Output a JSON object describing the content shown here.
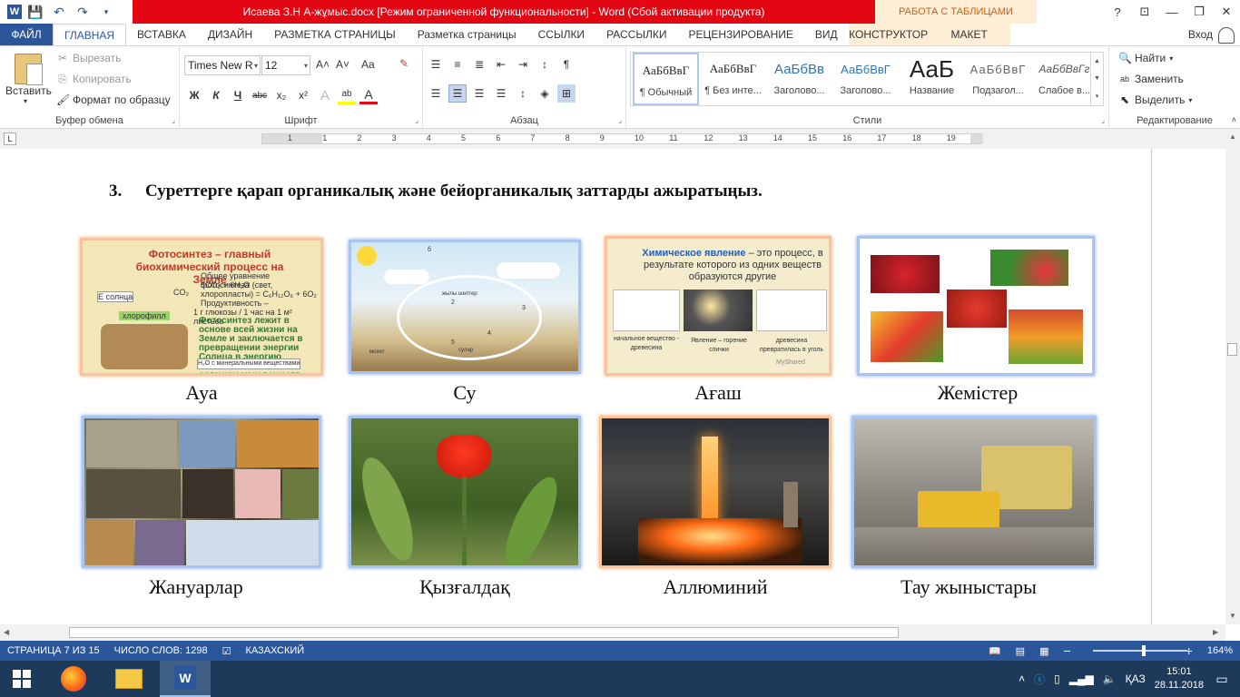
{
  "titlebar": {
    "title": "Исаева З.Н   А-жұмыс.docx [Режим ограниченной функциональности] -  Word (Сбой активации продукта)",
    "context_tab_header": "РАБОТА С ТАБЛИЦАМИ",
    "controls": {
      "help": "?",
      "ribbon_options": "⊡",
      "minimize": "—",
      "restore": "❐",
      "close": "✕"
    }
  },
  "tabs": {
    "file": "ФАЙЛ",
    "items": [
      "ГЛАВНАЯ",
      "ВСТАВКА",
      "ДИЗАЙН",
      "РАЗМЕТКА СТРАНИЦЫ",
      "Разметка страницы",
      "ССЫЛКИ",
      "РАССЫЛКИ",
      "РЕЦЕНЗИРОВАНИЕ",
      "ВИД"
    ],
    "context": [
      "КОНСТРУКТОР",
      "МАКЕТ"
    ],
    "login": "Вход"
  },
  "ribbon": {
    "clipboard": {
      "label": "Буфер обмена",
      "paste": "Вставить",
      "cut": "Вырезать",
      "copy": "Копировать",
      "format_painter": "Формат по образцу"
    },
    "font": {
      "label": "Шрифт",
      "font_name": "Times New R",
      "font_size": "12",
      "grow": "A˄",
      "shrink": "A˅",
      "case": "Aa",
      "bold": "Ж",
      "italic": "К",
      "underline": "Ч",
      "strike": "abc",
      "sub": "x₂",
      "sup": "x²",
      "text_effects": "A",
      "highlight": "ab",
      "font_color": "A"
    },
    "paragraph": {
      "label": "Абзац",
      "pilcrow": "¶"
    },
    "styles": {
      "label": "Стили",
      "items": [
        {
          "sample": "АаБбВвГ",
          "name": "¶ Обычный"
        },
        {
          "sample": "АаБбВвГ",
          "name": "¶ Без инте..."
        },
        {
          "sample": "АаБбВв",
          "name": "Заголово..."
        },
        {
          "sample": "АаБбВвГ",
          "name": "Заголово..."
        },
        {
          "sample": "АаБ",
          "name": "Название"
        },
        {
          "sample": "АаБбВвГ",
          "name": "Подзагол..."
        },
        {
          "sample": "АаБбВвГг",
          "name": "Слабое в..."
        }
      ]
    },
    "editing": {
      "label": "Редактирование",
      "find": "Найти",
      "replace": "Заменить",
      "select": "Выделить"
    }
  },
  "ruler": {
    "numbers": [
      "1",
      "1",
      "2",
      "3",
      "4",
      "5",
      "6",
      "7",
      "8",
      "9",
      "10",
      "11",
      "12",
      "13",
      "14",
      "15",
      "16",
      "17",
      "18",
      "19"
    ]
  },
  "document": {
    "heading_number": "3.",
    "heading_text": "Суреттерге қарап органикалық және бейорганикалық заттарды ажыратыңыз.",
    "pictures": [
      {
        "caption": "Ауа",
        "title": "Фотосинтез – главный биохимический процесс на Земле",
        "lines": [
          "Общее уравнение фотосинтеза",
          "6CO₂ + 6H₂O (свет, хлоропласты) = C₆H₁₂O₆ + 6O₂",
          "Продуктивность –",
          "1 г глюкозы / 1 час на 1 м² листьев"
        ],
        "green_text": "Фотосинтез лежит в основе всей жизни на Земле и заключается в превращении энергии Солнца в энергию химических связей органических веществ.",
        "labels": [
          "Е солнца",
          "CO₂",
          "хлорофилл",
          "H₂O с минеральными веществами"
        ]
      },
      {
        "caption": "Су",
        "labels": [
          "б",
          "жылы шелтер",
          "2",
          "4",
          "3",
          "5",
          "мохит",
          "сулар"
        ]
      },
      {
        "caption": "Ағаш",
        "title_colored": "Химическое явление",
        "title_rest": " – это процесс, в результате которого из одних веществ образуются другие",
        "labels": [
          "начальное вещество - древесина",
          "Явление – горение спички",
          "древесина превратилась в уголь"
        ],
        "watermark": "MyShared"
      },
      {
        "caption": "Жемістер"
      },
      {
        "caption": "Жануарлар"
      },
      {
        "caption": "Қызғалдақ"
      },
      {
        "caption": "Аллюминий"
      },
      {
        "caption": "Тау жыныстары"
      }
    ]
  },
  "statusbar": {
    "page": "СТРАНИЦА 7 ИЗ 15",
    "words": "ЧИСЛО СЛОВ: 1298",
    "language": "КАЗАХСКИЙ",
    "zoom_minus": "−",
    "zoom_plus": "+",
    "zoom": "164%",
    "zoom_level_percent": 164
  },
  "taskbar": {
    "language": "ҚАЗ",
    "time": "15:01",
    "date": "28.11.2018"
  },
  "colors": {
    "word_blue": "#2b579a",
    "title_red": "#e30613",
    "context_tab": "#fdeed5",
    "taskbar": "#1e3a5a"
  }
}
